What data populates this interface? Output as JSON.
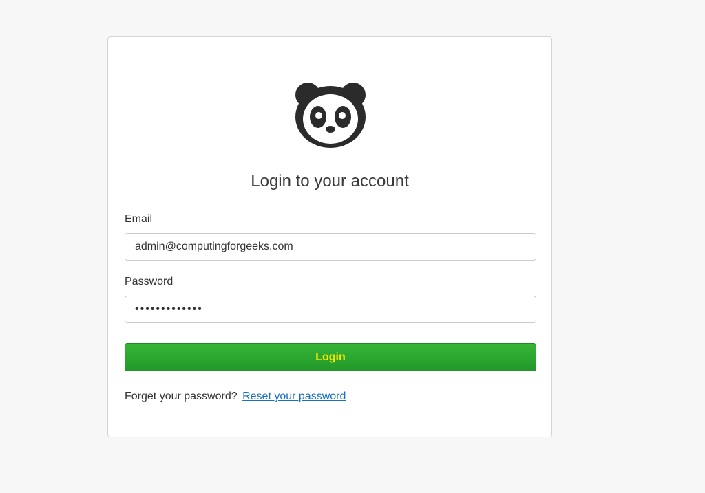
{
  "logo": {
    "icon": "panda-logo-icon"
  },
  "title": "Login to your account",
  "email": {
    "label": "Email",
    "value": "admin@computingforgeeks.com"
  },
  "password": {
    "label": "Password",
    "masked_value": "•••••••••••••"
  },
  "login_button": {
    "label": "Login"
  },
  "forgot": {
    "text": "Forget your password?",
    "link_text": "Reset your password"
  },
  "colors": {
    "page_background": "#f7f7f7",
    "button_green": "#2ba52b",
    "button_text": "#f7e600",
    "link": "#1a6fc2"
  }
}
